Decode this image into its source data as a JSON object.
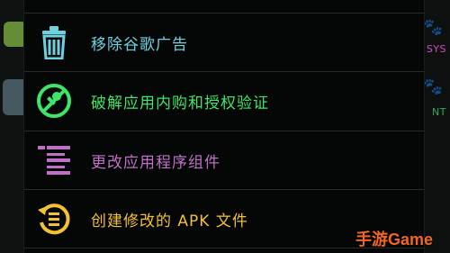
{
  "background": {
    "right_labels": [
      {
        "text": "SYS",
        "color": "#d44cc6"
      },
      {
        "text": "NT",
        "color": "#2aaf5a"
      }
    ]
  },
  "menu": {
    "items": [
      {
        "label": "移除谷歌广告",
        "icon": "trash-icon",
        "color": "#6fd0e0"
      },
      {
        "label": "破解应用内购和授权验证",
        "icon": "no-key-icon",
        "color": "#3fe56a"
      },
      {
        "label": "更改应用程序组件",
        "icon": "component-list-icon",
        "color": "#c070c8"
      },
      {
        "label": "创建修改的 APK 文件",
        "icon": "apk-history-icon",
        "color": "#f2c230"
      }
    ]
  },
  "watermark": {
    "text": "手游Game",
    "color": "#f26522"
  }
}
